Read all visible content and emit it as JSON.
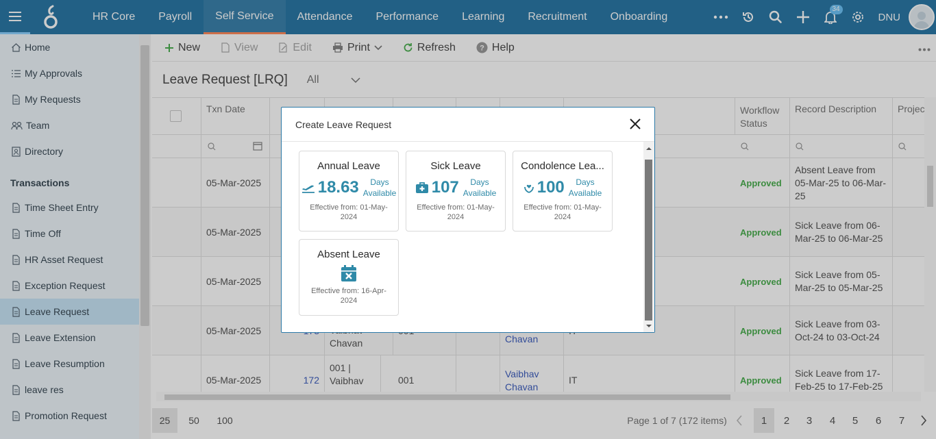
{
  "topnav": {
    "items": [
      "HR Core",
      "Payroll",
      "Self Service",
      "Attendance",
      "Performance",
      "Learning",
      "Recruitment",
      "Onboarding"
    ],
    "active_index": 2,
    "notification_count": "34",
    "user_initials": "DNU"
  },
  "sidebar": {
    "top_items": [
      "Home",
      "My Approvals",
      "My Requests",
      "Team",
      "Directory"
    ],
    "section_title": "Transactions",
    "transaction_items": [
      "Time Sheet Entry",
      "Time Off",
      "HR Asset Request",
      "Exception Request",
      "Leave Request",
      "Leave Extension",
      "Leave Resumption",
      "leave res",
      "Promotion Request"
    ],
    "active_item": "Leave Request"
  },
  "toolbar": {
    "new_label": "New",
    "view_label": "View",
    "edit_label": "Edit",
    "print_label": "Print",
    "refresh_label": "Refresh",
    "help_label": "Help"
  },
  "page": {
    "title": "Leave Request [LRQ]",
    "filter_value": "All"
  },
  "grid": {
    "headers": {
      "txn_date": "Txn Date",
      "workflow_status": "Workflow Status",
      "record_description": "Record Description",
      "project": "Projec"
    },
    "rows": [
      {
        "txn_date": "05-Mar-2025",
        "no": "",
        "emp": "",
        "code": "",
        "name": "",
        "dept": "",
        "status": "Approved",
        "desc": "Absent Leave from 05-Mar-25 to 06-Mar-25"
      },
      {
        "txn_date": "05-Mar-2025",
        "no": "",
        "emp": "",
        "code": "",
        "name": "",
        "dept": "",
        "status": "Approved",
        "desc": "Sick Leave from 06-Mar-25 to 06-Mar-25"
      },
      {
        "txn_date": "05-Mar-2025",
        "no": "",
        "emp": "",
        "code": "",
        "name": "",
        "dept": "",
        "status": "Approved",
        "desc": "Sick Leave from 05-Mar-25 to 05-Mar-25"
      },
      {
        "txn_date": "05-Mar-2025",
        "no": "173",
        "emp": "Vaibhav Chavan",
        "code": "001",
        "name": "Chavan",
        "dept": "IT",
        "status": "Approved",
        "desc": "Sick Leave from 03-Oct-24 to 03-Oct-24"
      },
      {
        "txn_date": "05-Mar-2025",
        "no": "172",
        "emp": "001 | Vaibhav",
        "code": "001",
        "name": "Vaibhav Chavan",
        "dept": "IT",
        "status": "Approved",
        "desc": "Sick Leave from 17-Feb-25 to 17-Feb-25"
      }
    ]
  },
  "pager": {
    "sizes": [
      "25",
      "50",
      "100"
    ],
    "info": "Page 1 of 7 (172 items)",
    "pages": [
      "1",
      "2",
      "3",
      "4",
      "5",
      "6",
      "7"
    ]
  },
  "modal": {
    "title": "Create Leave Request",
    "cards": [
      {
        "title": "Annual Leave",
        "icon": "plane-icon",
        "balance": "18.63",
        "days_label_1": "Days",
        "days_label_2": "Available",
        "effective": "Effective from: 01-May-2024"
      },
      {
        "title": "Sick Leave",
        "icon": "medical-kit-icon",
        "balance": "107",
        "days_label_1": "Days",
        "days_label_2": "Available",
        "effective": "Effective from: 01-May-2024"
      },
      {
        "title": "Condolence Lea...",
        "icon": "hands-heart-icon",
        "balance": "100",
        "days_label_1": "Days",
        "days_label_2": "Available",
        "effective": "Effective from: 01-May-2024"
      },
      {
        "title": "Absent Leave",
        "icon": "calendar-x-icon",
        "balance": "",
        "effective": "Effective from: 16-Apr-2024"
      }
    ]
  },
  "colors": {
    "nav_bg": "#2b79a7",
    "accent_teal": "#2f8aa8",
    "active_tab_underline": "#ff8a5c",
    "approved": "#4caf50",
    "link": "#3f5fbf"
  }
}
